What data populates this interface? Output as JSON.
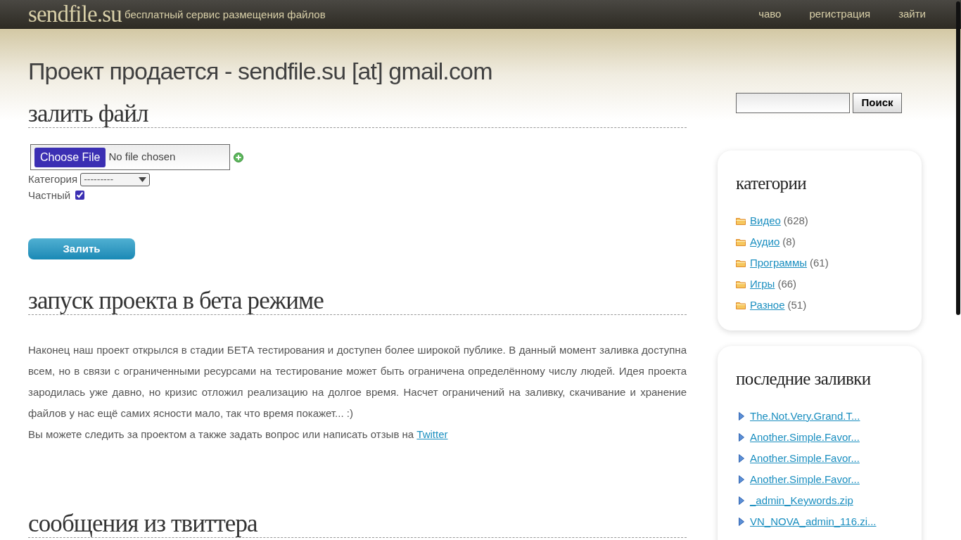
{
  "header": {
    "logo": "sendfile.su",
    "tagline": "бесплатный сервис размещения файлов",
    "nav": [
      "чаво",
      "регистрация",
      "зайти"
    ]
  },
  "banner": "Проект продается - sendfile.su [at] gmail.com",
  "upload": {
    "title": "залить файл",
    "file_button": "Choose File",
    "file_status": "No file chosen",
    "category_label": "Категория",
    "category_value": "---------",
    "private_label": "Частный",
    "private_checked": true,
    "submit": "Залить"
  },
  "news": {
    "title": "запуск проекта в бета режиме",
    "paragraph": "Наконец наш проект открылся в стадии БЕТА тестирования и доступен более широкой публике. В данный момент заливка доступна всем, но в связи с ограниченными ресурсами на тестирование может быть ограничена определённому числу людей. Идея проекта зародилась уже давно, но кризис отложил реализацию на долгое время. Насчет ограничений на заливку, скачивание и хранение файлов у нас ещё самих ясности мало, так что время покажет... :)",
    "follow_text": "Вы можете следить за проектом а также задать вопрос или написать отзыв на",
    "follow_link": "Twitter"
  },
  "twitter": {
    "title": "сообщения из твиттера"
  },
  "sidebar": {
    "search_button": "Поиск",
    "categories": {
      "title": "категории",
      "items": [
        {
          "label": "Видео",
          "count": "(628)"
        },
        {
          "label": "Аудио",
          "count": "(8)"
        },
        {
          "label": "Программы",
          "count": "(61)"
        },
        {
          "label": "Игры",
          "count": "(66)"
        },
        {
          "label": "Разное",
          "count": "(51)"
        }
      ]
    },
    "recent": {
      "title": "последние заливки",
      "items": [
        "The.Not.Very.Grand.T...",
        "Another.Simple.Favor...",
        "Another.Simple.Favor...",
        "Another.Simple.Favor...",
        "_admin_Keywords.zip",
        "VN_NOVA_admin_116.zi..."
      ]
    }
  }
}
